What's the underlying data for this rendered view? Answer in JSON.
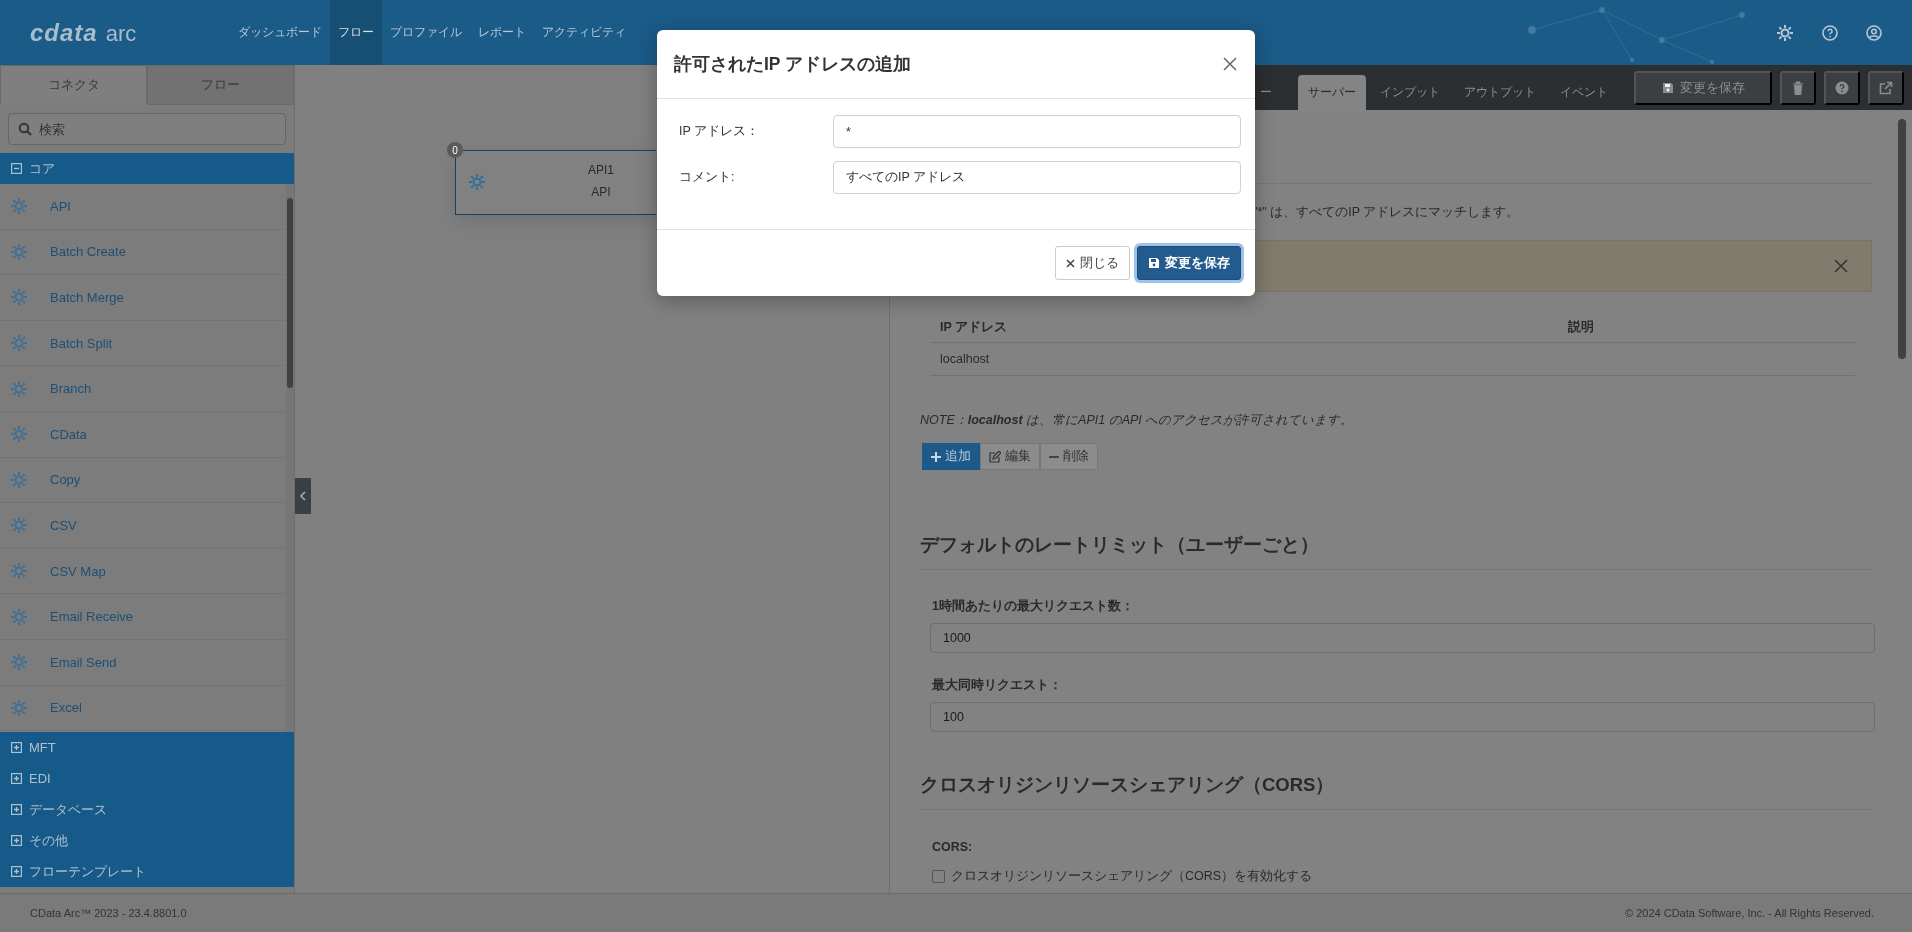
{
  "topbar": {
    "logo": {
      "brand": "cdata",
      "product": "arc"
    },
    "nav": [
      {
        "label": "ダッシュボード",
        "selected": false
      },
      {
        "label": "フロー",
        "selected": true
      },
      {
        "label": "プロファイル",
        "selected": false
      },
      {
        "label": "レポート",
        "selected": false
      },
      {
        "label": "アクティビティ",
        "selected": false
      }
    ]
  },
  "sidebar": {
    "tabs": [
      {
        "label": "コネクタ",
        "selected": true
      },
      {
        "label": "フロー",
        "selected": false
      }
    ],
    "search": {
      "placeholder": "検索"
    },
    "categories": [
      {
        "label": "コア",
        "expanded": true,
        "items": [
          "API",
          "Batch Create",
          "Batch Merge",
          "Batch Split",
          "Branch",
          "CData",
          "Copy",
          "CSV",
          "CSV Map",
          "Email Receive",
          "Email Send",
          "Excel"
        ]
      },
      {
        "label": "MFT",
        "expanded": false
      },
      {
        "label": "EDI",
        "expanded": false
      },
      {
        "label": "データベース",
        "expanded": false
      },
      {
        "label": "その他",
        "expanded": false
      },
      {
        "label": "フローテンプレート",
        "expanded": false
      }
    ]
  },
  "canvas": {
    "nodes": [
      {
        "badge": "0",
        "title": "API1",
        "type": "API"
      }
    ]
  },
  "panel": {
    "tabs": [
      {
        "label": "ー",
        "selected": false
      },
      {
        "label": "サーバー",
        "selected": true
      },
      {
        "label": "インプット",
        "selected": false
      },
      {
        "label": "アウトプット",
        "selected": false
      },
      {
        "label": "イベント",
        "selected": false
      }
    ],
    "save_button": "変更を保存",
    "match_note": "\"*\" は、すべてのIP アドレスにマッチします。",
    "table": {
      "columns": [
        "IP アドレス",
        "説明"
      ],
      "rows": [
        {
          "ip": "localhost"
        }
      ]
    },
    "note": "NOTE：**localhost** は、常にAPI1 のAPI へのアクセスが許可されています。",
    "actions": [
      {
        "kind": "add",
        "label": "追加",
        "disabled": false
      },
      {
        "kind": "edit",
        "label": "編集",
        "disabled": true
      },
      {
        "kind": "delete",
        "label": "削除",
        "disabled": true
      }
    ],
    "rate_limit": {
      "heading": "デフォルトのレートリミット（ユーザーごと）",
      "fields": [
        {
          "label": "1時間あたりの最大リクエスト数：",
          "value": "1000"
        },
        {
          "label": "最大同時リクエスト：",
          "value": "100"
        }
      ]
    },
    "cors": {
      "heading": "クロスオリジンリソースシェアリング（CORS）",
      "label": "CORS:",
      "checkbox": {
        "label": "クロスオリジンリソースシェアリング（CORS）を有効化する",
        "checked": false
      }
    }
  },
  "footer": {
    "version": "CData Arc™ 2023 - 23.4.8801.0",
    "copyright": "© 2024 CData Software, Inc. - All Rights Reserved."
  },
  "modal": {
    "title": "許可されたIP アドレスの追加",
    "fields": [
      {
        "label": "IP アドレス：",
        "value": "*"
      },
      {
        "label": "コメント:",
        "value": "すべてのIP アドレス"
      }
    ],
    "buttons": [
      {
        "kind": "close",
        "label": "閉じる"
      },
      {
        "kind": "save",
        "label": "変更を保存"
      }
    ]
  }
}
